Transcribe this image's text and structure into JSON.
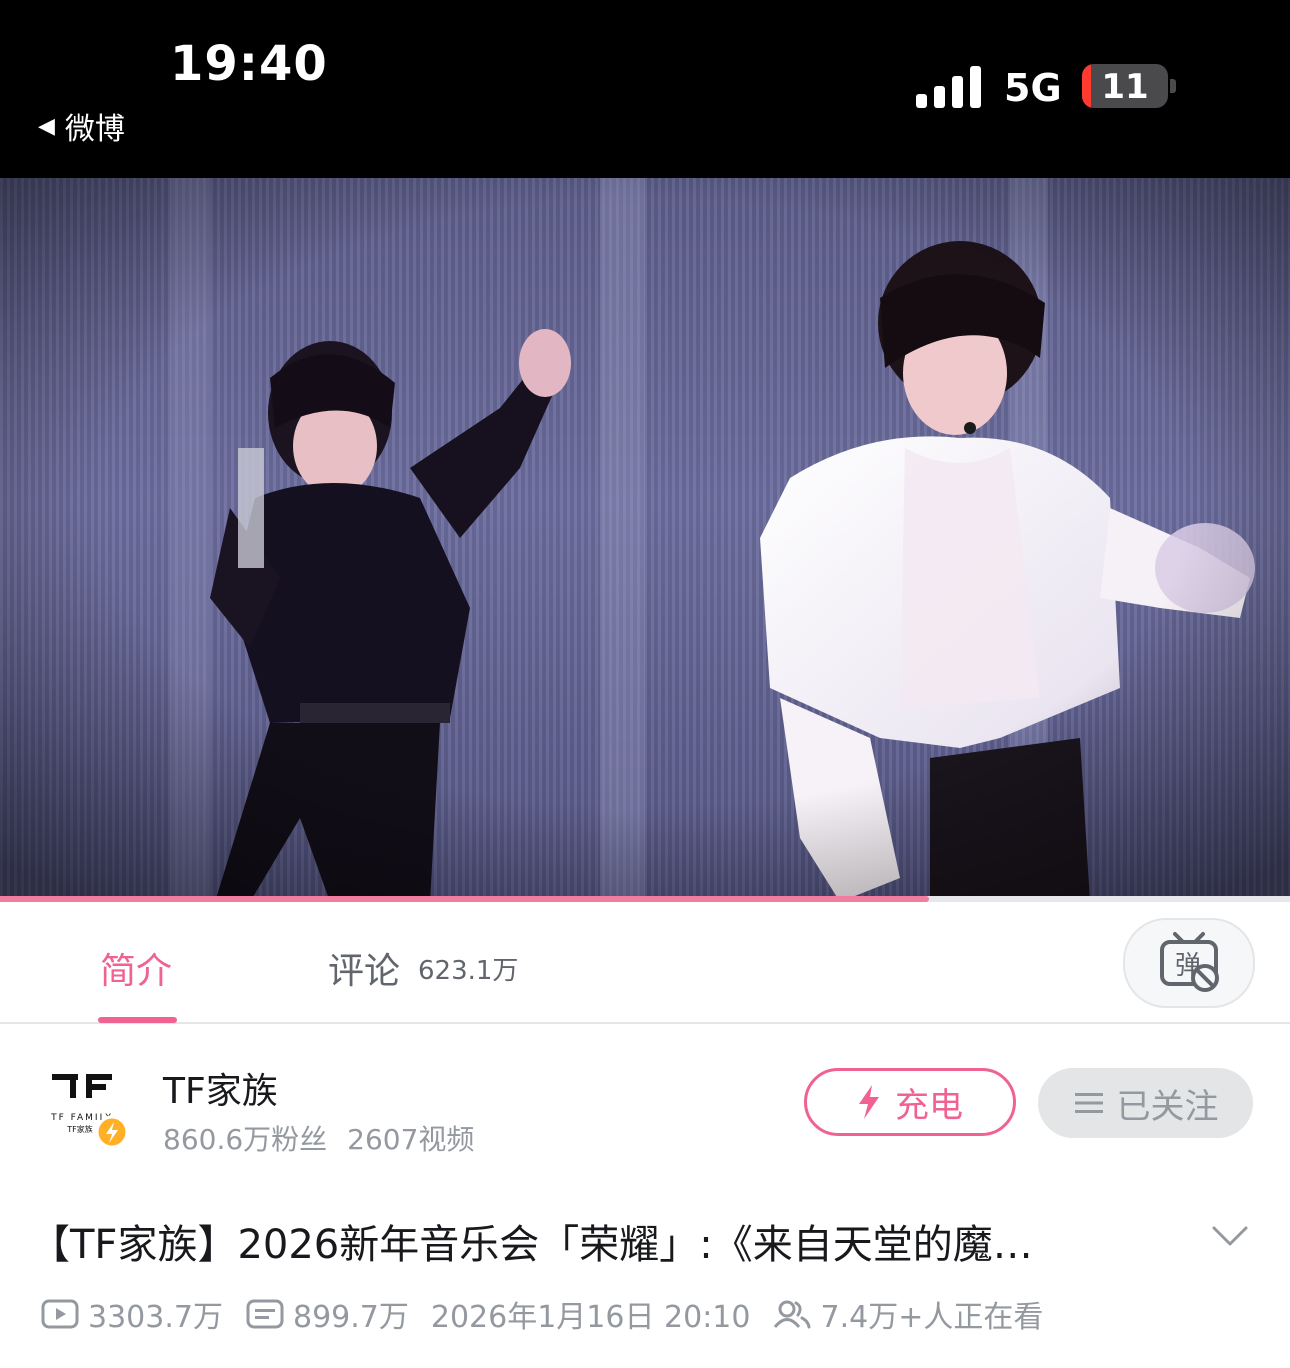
{
  "status_bar": {
    "time": "19:40",
    "back_app": "微博",
    "network": "5G",
    "battery": "11",
    "battery_level_percent": 11
  },
  "player": {
    "progress_percent": 72
  },
  "tabs": {
    "intro_label": "简介",
    "comments_label": "评论",
    "comments_count": "623.1万"
  },
  "uploader": {
    "name": "TF家族",
    "logo_text": "TF FAMILY",
    "logo_subtext": "TF家族",
    "fans": "860.6万粉丝",
    "videos": "2607视频",
    "charge_label": "充电",
    "follow_label": "已关注"
  },
  "video": {
    "title": "【TF家族】2026新年音乐会「荣耀」:《来自天堂的魔…",
    "plays": "3303.7万",
    "danmaku": "899.7万",
    "date": "2026年1月16日 20:10",
    "watching": "7.4万+人正在看"
  },
  "colors": {
    "accent": "#f06292",
    "progress": "#f37da0",
    "muted_text": "#9499a0"
  }
}
